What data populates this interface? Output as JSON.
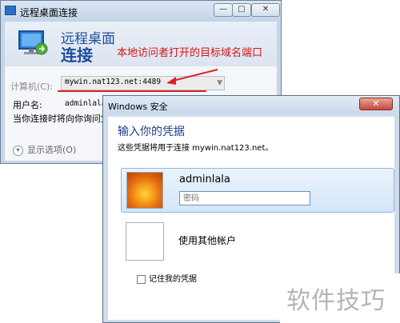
{
  "rdp_window": {
    "title": "远程桌面连接",
    "hero_line1": "远程桌面",
    "hero_line2": "连接",
    "annotation": "本地访问者打开的目标域名端口",
    "computer_label": "计算机(C):",
    "computer_value": "mywin.nat123.net:4489",
    "user_label": "用户名:",
    "user_value": "adminlala",
    "connect_note": "当你连接时将向你询问凭",
    "options_label": "显示选项(O)",
    "buttons": {
      "minimize": "—",
      "maximize": "□",
      "close": "✕"
    },
    "icon": "remote-desktop-monitor-icon",
    "accent_color": "#1e4e9b",
    "annotation_color": "#d41414"
  },
  "security_dialog": {
    "title": "Windows 安全",
    "close": "✕",
    "heading": "输入你的凭据",
    "subtext": "这些凭据将用于连接 mywin.nat123.net。",
    "user_tile": {
      "name": "adminlala",
      "password_placeholder": "密码",
      "avatar": "flower-avatar"
    },
    "other_account": "使用其他帐户",
    "remember": "记住我的凭据"
  },
  "watermark": "软件技巧"
}
